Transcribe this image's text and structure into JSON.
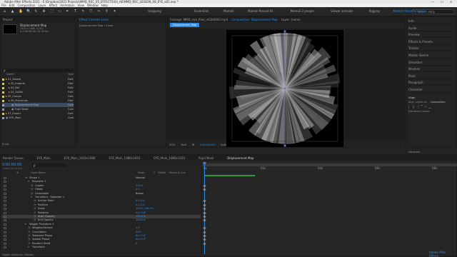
{
  "window": {
    "title": "Adobe After Effects 2021 - E:\\Dropbox\\2021 Projects\\MMD_REC_05_EFFECTS\\04_AE\\MMD_REC_LESSON_08_EYE_a01.aep *",
    "minimize": "—",
    "maximize": "☐",
    "close": "✕"
  },
  "menu": [
    "File",
    "Edit",
    "Composition",
    "Layer",
    "Effect",
    "Animation",
    "View",
    "Window",
    "Help"
  ],
  "toolbar": {
    "tools": [
      "⌂",
      "▲",
      "✋",
      "🔍",
      "↻",
      "✥",
      "⛶",
      "▭",
      "✒",
      "T",
      "✎",
      "⛉",
      "✂",
      "⚲",
      "✦"
    ],
    "snapping_label": "Snapping",
    "workspaces": [
      "Essentials",
      "Mamoli",
      "Mamoli Record 01",
      "Mamoli 2 people",
      "Viewer animate",
      "Rigging",
      "Mamoli Record Course"
    ],
    "active_workspace": "Mamoli Record Course",
    "search_placeholder": "Search Help"
  },
  "project": {
    "tab": "Project",
    "effect_controls_tab": "Effect Controls",
    "effect_controls_target": "Lines",
    "comp_name": "Displacement Map",
    "comp_info": [
      "1920 x 1080 (1.00)",
      "Δ 0:00:06:00, 25.00 fps"
    ],
    "effect_header": "Displacement Map • Lines",
    "search_placeholder": "ρ",
    "columns": [
      "Name",
      "Type"
    ],
    "items": [
      {
        "name": "01_Assets",
        "type": "Fold",
        "color": "#e8c34a",
        "indent": 0
      },
      {
        "name": "02_Imports",
        "type": "Fold",
        "color": "#e8c34a",
        "indent": 1
      },
      {
        "name": "03_Ref",
        "type": "Fold",
        "color": "#e8c34a",
        "indent": 1
      },
      {
        "name": "04_Solids",
        "type": "Fold",
        "color": "#e8c34a",
        "indent": 1
      },
      {
        "name": "05_Comps",
        "type": "Fold",
        "color": "#e8c34a",
        "indent": 0
      },
      {
        "name": "06_Precomps",
        "type": "Fold",
        "color": "#e8c34a",
        "indent": 1
      },
      {
        "name": "Displacement Map",
        "type": "Com",
        "color": "#8fa0c4",
        "indent": 2,
        "selected": true
      },
      {
        "name": "Pupil Mask",
        "type": "Com",
        "color": "#8fa0c4",
        "indent": 2
      },
      {
        "name": "07_Export",
        "type": "Fold",
        "color": "#e8c34a",
        "indent": 0
      },
      {
        "name": "EYE_Main",
        "type": "Com",
        "color": "#8fa0c4",
        "indent": 0
      }
    ],
    "footer_bpc": "8 bpc"
  },
  "viewer": {
    "tabs": [
      "Footage: MMD_eye_final_v02b0000.mp4",
      "Composition: Displacement Map",
      "Layer: (none)"
    ],
    "active_tab": "Composition: Displacement Map",
    "comp_tab_label": "Displacement Map",
    "zoom": "50%",
    "resolution": "Half",
    "timecode": "0:00:00:00",
    "camera": "Active Camera",
    "view": "1 View",
    "exposure": "+0.0"
  },
  "right_panel": {
    "items": [
      "Info",
      "Audio",
      "Preview",
      "Effects & Presets",
      "Tracker",
      "Motion Sketch",
      "Smoother",
      "Brushes",
      "Paint",
      "Paragraph",
      "Character"
    ],
    "align": {
      "title": "Align",
      "align_to_label": "Align Layers to:",
      "align_to_value": "Composition",
      "distribute_label": "Distribute Layers:"
    },
    "libraries": "Libraries"
  },
  "timeline": {
    "tabs": [
      "Render Queue",
      "EYE_Main",
      "EYE_Main_1920x1080",
      "EYE_Main_1080x1920",
      "EYE_Main_1080x1350",
      "Pupil Mask",
      "Displacement Map"
    ],
    "active_tab": "Displacement Map",
    "timecode": "0:00:00:00",
    "fps_info": "00000 (25.00 fps)",
    "search_placeholder": "ρ",
    "columns": [
      "#",
      "Layer Name",
      "Mode",
      "T",
      "TrkMat",
      "Parent & Link"
    ],
    "ruler": [
      "0s",
      "02s",
      "04s",
      "06s",
      "08s"
    ],
    "rows": [
      {
        "indent": 3,
        "name": "Shape 1",
        "value": "Normal",
        "plain": true
      },
      {
        "indent": 4,
        "name": "Repeater 1",
        "value": ""
      },
      {
        "indent": 5,
        "name": "Copies",
        "value": "100.0"
      },
      {
        "indent": 5,
        "name": "Offset",
        "value": "0.0"
      },
      {
        "indent": 5,
        "name": "Composite",
        "value": "Below",
        "plain": true
      },
      {
        "indent": 5,
        "name": "Transform : Repeater 1",
        "value": ""
      },
      {
        "indent": 6,
        "name": "Anchor Point",
        "value": "0.0,0.0"
      },
      {
        "indent": 6,
        "name": "Position",
        "value": "0.0,0.0"
      },
      {
        "indent": 6,
        "name": "Scale",
        "value": "100.0,100.0%"
      },
      {
        "indent": 6,
        "name": "Rotation",
        "value": "0x+3.6°"
      },
      {
        "indent": 6,
        "name": "Start Opacity",
        "value": "100.0%",
        "highlight": true
      },
      {
        "indent": 6,
        "name": "End Opacity",
        "value": "100.0%"
      },
      {
        "indent": 3,
        "name": "Wiggle Transform 1",
        "value": ""
      },
      {
        "indent": 4,
        "name": "Wiggles/Second",
        "value": "2.0"
      },
      {
        "indent": 4,
        "name": "Correlation",
        "value": "50%"
      },
      {
        "indent": 4,
        "name": "Temporal Phase",
        "value": "0x+0.0°"
      },
      {
        "indent": 4,
        "name": "Spatial Phase",
        "value": "0x+0.0°"
      },
      {
        "indent": 4,
        "name": "Random Seed",
        "value": "0"
      },
      {
        "indent": 4,
        "name": "Transform",
        "value": ""
      }
    ],
    "footer": "Toggle Switches / Modes",
    "watermark": "Adobe After Effects"
  },
  "colors": {
    "accent": "#2d8ceb",
    "panel": "#232323",
    "dark": "#1b1b1b",
    "value": "#2f8fe8",
    "label_yellow": "#e8c34a",
    "label_comp": "#8fa0c4"
  },
  "chart_data": null
}
